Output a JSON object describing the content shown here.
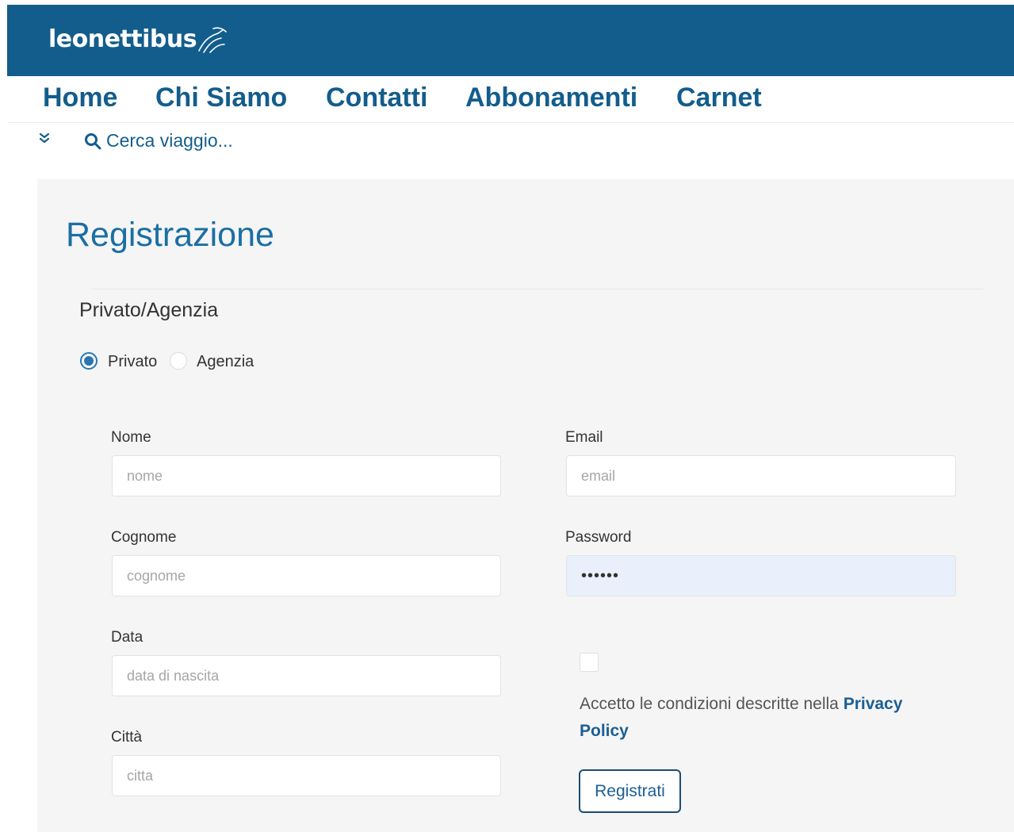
{
  "header": {
    "logo_text": "leonettibus",
    "logo_icon": "horse-icon",
    "bg_color": "#135d8c"
  },
  "nav": {
    "items": [
      {
        "label": "Home"
      },
      {
        "label": "Chi Siamo"
      },
      {
        "label": "Contatti"
      },
      {
        "label": "Abbonamenti"
      },
      {
        "label": "Carnet"
      }
    ],
    "color": "#135d8c"
  },
  "search": {
    "toggle_icon": "double-chevron-down-icon",
    "icon": "search-icon",
    "label": "Cerca viaggio..."
  },
  "form": {
    "title": "Registrazione",
    "type_section": {
      "label": "Privato/Agenzia",
      "options": [
        {
          "label": "Privato",
          "selected": true
        },
        {
          "label": "Agenzia",
          "selected": false
        }
      ]
    },
    "fields": {
      "nome": {
        "label": "Nome",
        "placeholder": "nome",
        "value": ""
      },
      "cognome": {
        "label": "Cognome",
        "placeholder": "cognome",
        "value": ""
      },
      "data": {
        "label": "Data",
        "placeholder": "data di nascita",
        "value": ""
      },
      "citta": {
        "label": "Città",
        "placeholder": "citta",
        "value": ""
      },
      "email": {
        "label": "Email",
        "placeholder": "email",
        "value": ""
      },
      "password": {
        "label": "Password",
        "placeholder": "",
        "value": "••••••"
      }
    },
    "consent": {
      "checked": false,
      "text": "Accetto le condizioni descritte nella ",
      "link_label": "Privacy Policy"
    },
    "submit_label": "Registrati",
    "accent_color": "#1b5f95"
  }
}
